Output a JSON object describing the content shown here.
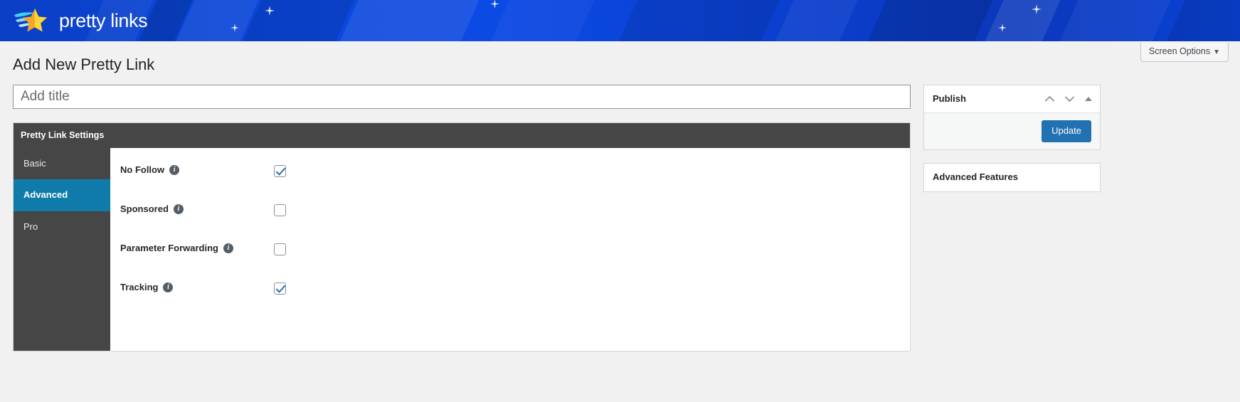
{
  "brand": {
    "name": "pretty links",
    "logo_icon": "pretty-links-star-logo",
    "bar_color": "#0b42d4"
  },
  "screen_options": {
    "label": "Screen Options",
    "caret_icon": "chevron-down-icon",
    "caret_glyph": "▼"
  },
  "page": {
    "title": "Add New Pretty Link"
  },
  "title_field": {
    "value": "",
    "placeholder": "Add title"
  },
  "settings": {
    "header": "Pretty Link Settings",
    "active_color": "#0f7bab",
    "header_bg": "#464646",
    "tabs": [
      {
        "label": "Basic",
        "active": false
      },
      {
        "label": "Advanced",
        "active": true
      },
      {
        "label": "Pro",
        "active": false
      }
    ],
    "fields": [
      {
        "label": "No Follow",
        "info_icon": "info-icon",
        "checked": true
      },
      {
        "label": "Sponsored",
        "info_icon": "info-icon",
        "checked": false
      },
      {
        "label": "Parameter Forwarding",
        "info_icon": "info-icon",
        "checked": false
      },
      {
        "label": "Tracking",
        "info_icon": "info-icon",
        "checked": true
      }
    ]
  },
  "sidebar": {
    "publish": {
      "title": "Publish",
      "up_icon": "chevron-up-icon",
      "down_icon": "chevron-down-icon",
      "toggle_icon": "triangle-up-icon",
      "update_label": "Update",
      "update_color": "#2271b1"
    },
    "advanced_features": {
      "title": "Advanced Features"
    }
  }
}
